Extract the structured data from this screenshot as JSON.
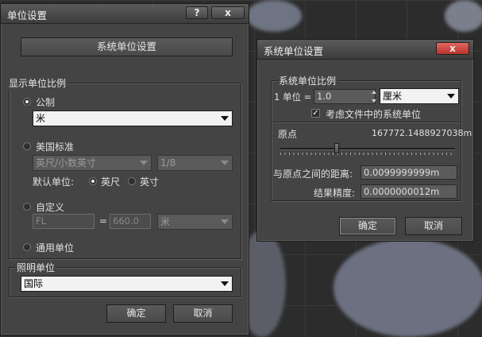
{
  "units_dialog": {
    "title": "单位设置",
    "help_label": "?",
    "close_label": "x",
    "system_units_button": "系统单位设置",
    "display_scale": {
      "label": "显示单位比例",
      "metric_label": "公制",
      "metric_value": "米",
      "us_standard_label": "美国标准",
      "us_standard_value": "英尺/小数英寸",
      "us_fraction_value": "1/8",
      "default_unit_label": "默认单位:",
      "feet_label": "英尺",
      "inches_label": "英寸",
      "custom_label": "自定义",
      "custom_name_value": "FL",
      "equals_label": "=",
      "custom_amount_value": "660.0",
      "custom_unit_value": "米",
      "generic_label": "通用单位"
    },
    "lighting": {
      "label": "照明单位",
      "value": "国际"
    },
    "ok_label": "确定",
    "cancel_label": "取消"
  },
  "system_dialog": {
    "title": "系统单位设置",
    "close_label": "x",
    "scale_group_label": "系统单位比例",
    "unit_label": "1 单位 =",
    "unit_value": "1.0",
    "unit_type_value": "厘米",
    "consider_file_label": "考虑文件中的系统单位",
    "consider_file_checked": true,
    "origin_label": "原点",
    "origin_value": "167772.1488927038m",
    "slider_position_fraction": 0.32,
    "distance_label": "与原点之间的距离:",
    "distance_value": "0.0099999999m",
    "precision_label": "结果精度:",
    "precision_value": "0.0000000012m",
    "ok_label": "确定",
    "cancel_label": "取消"
  },
  "colors": {
    "dialog_bg": "#444444",
    "close_red": "#c9433b",
    "input_white": "#f2f2f2"
  }
}
